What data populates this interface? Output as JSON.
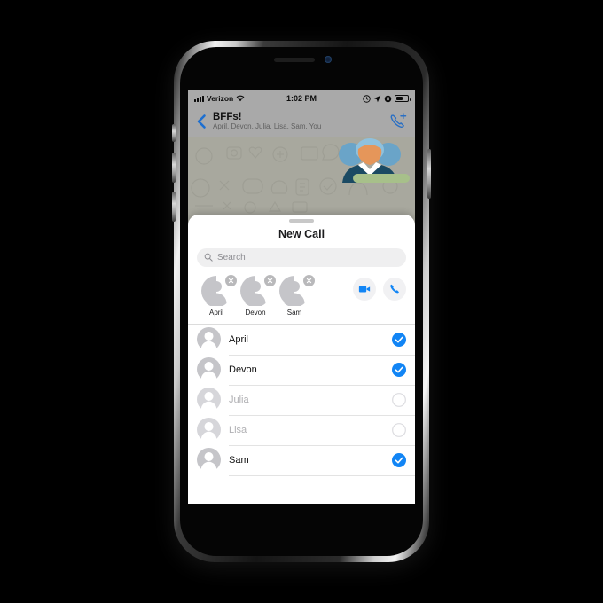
{
  "device": {
    "name": "iphone-mockup"
  },
  "status_bar": {
    "carrier": "Verizon",
    "time": "1:02 PM",
    "wifi_icon": "wifi-icon",
    "signal_icon": "signal-bars-icon",
    "alarm_icon": "alarm-clock-icon",
    "location_icon": "location-arrow-icon",
    "rotation_lock_icon": "rotation-lock-icon",
    "battery_icon": "battery-icon"
  },
  "chat_header": {
    "back_icon": "back-chevron-icon",
    "title": "BFFs!",
    "participants": "April, Devon, Julia, Lisa, Sam, You",
    "add_call_icon": "add-call-icon"
  },
  "sheet": {
    "grabber": "sheet-grabber",
    "title": "New Call",
    "search": {
      "placeholder": "Search",
      "value": "",
      "icon": "search-icon"
    },
    "selected_chips": [
      {
        "name": "April",
        "avatar_icon": "person-avatar-icon",
        "remove_icon": "remove-x-icon"
      },
      {
        "name": "Devon",
        "avatar_icon": "person-avatar-icon",
        "remove_icon": "remove-x-icon"
      },
      {
        "name": "Sam",
        "avatar_icon": "person-avatar-icon",
        "remove_icon": "remove-x-icon"
      }
    ],
    "actions": [
      {
        "name": "video-call-button",
        "icon": "video-camera-icon"
      },
      {
        "name": "audio-call-button",
        "icon": "phone-handset-icon"
      }
    ],
    "contacts": [
      {
        "name": "April",
        "selected": true
      },
      {
        "name": "Devon",
        "selected": true
      },
      {
        "name": "Julia",
        "selected": false
      },
      {
        "name": "Lisa",
        "selected": false
      },
      {
        "name": "Sam",
        "selected": true
      }
    ]
  },
  "colors": {
    "accent_blue": "#1285f5",
    "header_gray": "#a9a9a9",
    "avatar_gray": "#c5c5c9",
    "sheet_white": "#ffffff",
    "placeholder_gray": "#8e8e93",
    "dim_text": "#b0b0b3"
  }
}
